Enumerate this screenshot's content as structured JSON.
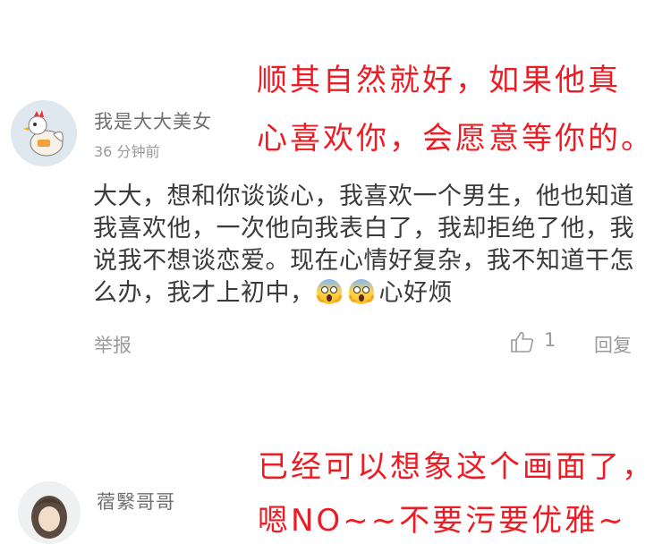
{
  "overlay_top": {
    "line1": "顺其自然就好，如果他真",
    "line2": "心喜欢你，会愿意等你的。"
  },
  "comment1": {
    "username": "我是大大美女",
    "time": "36 分钟前",
    "text": "大大，想和你谈谈心，我喜欢一个男生，他也知道我喜欢他，一次他向我表白了，我却拒绝了他，我说我不想谈恋爱。现在心情好复杂，我不知道干怎么办，我才上初中，",
    "text_tail": "心好烦",
    "emoji": [
      "scream-emoji",
      "scream-emoji"
    ],
    "report_label": "举报",
    "like_count": "1",
    "reply_label": "回复"
  },
  "overlay_bottom": {
    "line1": "已经可以想象这个画面了，",
    "line2": "嗯NO~~不要污要优雅~"
  },
  "comment2": {
    "username": "蓿繄哥哥"
  },
  "colors": {
    "accent_red": "#ec1c24",
    "text_main": "#3a3a3a",
    "text_muted": "#9b9b9b"
  }
}
